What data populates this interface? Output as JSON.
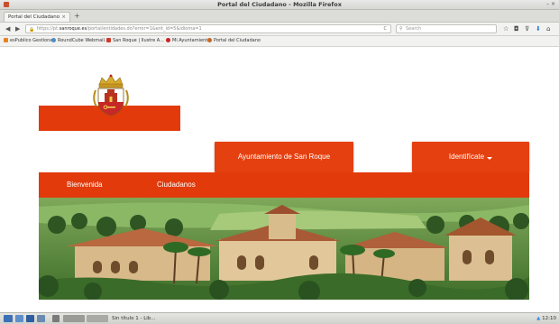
{
  "window": {
    "title": "Portal del Ciudadano - Mozilla Firefox",
    "controls": "– ×"
  },
  "tabs": [
    {
      "label": "Portal del Ciudadano",
      "close": "×"
    }
  ],
  "new_tab": "+",
  "nav": {
    "back": "◀",
    "forward": "▶",
    "url_prefix": "https://pt.",
    "url_domain": "sanroque.es",
    "url_rest": "/portal/entidades.do?error=1&ent_id=5&idioma=1",
    "reload": "C",
    "search_placeholder": "Search",
    "toolbar_icons": [
      "☆",
      "◘",
      "⊽",
      "⬇",
      "⌂"
    ]
  },
  "bookmarks": [
    {
      "label": "esPublico Gestiona",
      "color": "#e8821f"
    },
    {
      "label": "RoundCube Webmail...",
      "color": "#4c8dc9"
    },
    {
      "label": "San Roque | Ilustre A...",
      "color": "#d13a2a"
    },
    {
      "label": "Mi Ayuntamiento",
      "color": "#cc2222"
    },
    {
      "label": "Portal del Ciudadano",
      "color": "#c9661f"
    }
  ],
  "page": {
    "buttons": {
      "ayuntamiento": "Ayuntamiento de San Roque",
      "identificate": "Identifícate"
    },
    "menu": [
      "Bienvenida",
      "Ciudadanos"
    ]
  },
  "taskbar": {
    "task_label": "Sin título 1 - Lib...",
    "clock": "12:10"
  },
  "colors": {
    "brand_red": "#e23a0b",
    "button_red": "#e5400f"
  }
}
